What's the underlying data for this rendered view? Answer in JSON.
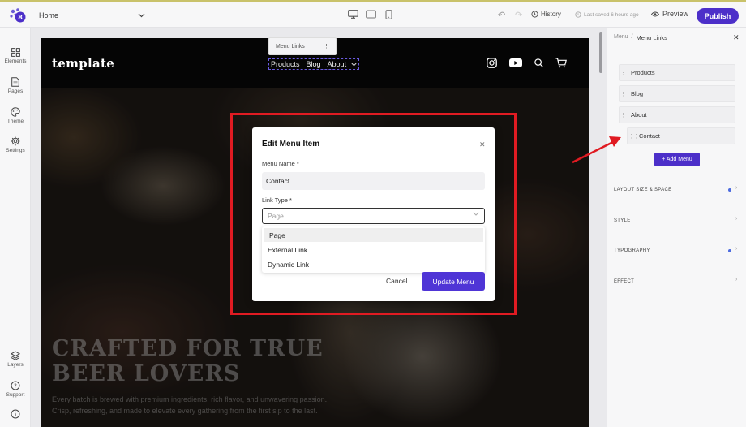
{
  "topbar": {
    "page_select": "Home",
    "history_label": "History",
    "saved_label": "Last saved 6 hours ago",
    "preview_label": "Preview",
    "publish_label": "Publish"
  },
  "leftbar": {
    "items": [
      {
        "label": "Elements",
        "icon": "grid-icon"
      },
      {
        "label": "Pages",
        "icon": "page-icon"
      },
      {
        "label": "Theme",
        "icon": "palette-icon"
      },
      {
        "label": "Settings",
        "icon": "gear-icon"
      }
    ],
    "bottom": [
      {
        "label": "Layers",
        "icon": "layers-icon"
      },
      {
        "label": "Support",
        "icon": "help-icon"
      },
      {
        "label": "",
        "icon": "info-icon"
      }
    ]
  },
  "site": {
    "logo": "template",
    "nav": [
      "Products",
      "Blog",
      "About"
    ],
    "hero_title": "CRAFTED FOR TRUE BEER LOVERS",
    "hero_text": "Every batch is brewed with premium ingredients, rich flavor, and unwavering passion. Crisp, refreshing, and made to elevate every gathering from the first sip to the last."
  },
  "context_chip": {
    "label": "Menu Links"
  },
  "modal": {
    "title": "Edit Menu Item",
    "menu_name_label": "Menu Name *",
    "menu_name_value": "Contact",
    "link_type_label": "Link Type *",
    "link_type_placeholder": "Page",
    "options": [
      "Page",
      "External Link",
      "Dynamic Link"
    ],
    "cancel_label": "Cancel",
    "update_label": "Update Menu"
  },
  "rightpanel": {
    "crumb_parent": "Menu",
    "crumb_sep": "/",
    "crumb_current": "Menu Links",
    "menu_items": [
      "Products",
      "Blog",
      "About",
      "Contact"
    ],
    "add_menu_label": "+ Add Menu",
    "sections": [
      "LAYOUT SIZE & SPACE",
      "STYLE",
      "TYPOGRAPHY",
      "EFFECT"
    ]
  },
  "colors": {
    "accent": "#4c2fc9",
    "highlight": "#e01b22"
  }
}
